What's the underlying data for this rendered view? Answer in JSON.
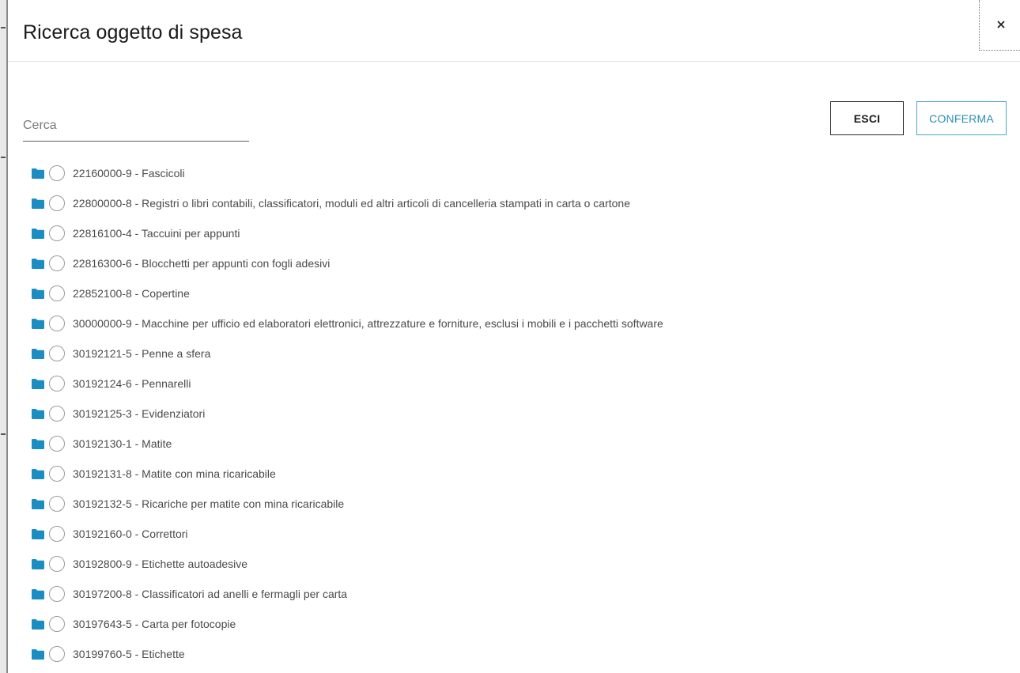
{
  "dialog": {
    "title": "Ricerca oggetto di spesa",
    "close_glyph": "×"
  },
  "search": {
    "placeholder": "Cerca",
    "value": ""
  },
  "buttons": {
    "exit_label": "ESCI",
    "confirm_label": "CONFERMA"
  },
  "icons": {
    "folder": "folder-icon",
    "close": "close-icon",
    "radio": "radio-empty"
  },
  "colors": {
    "accent": "#1b8dc2",
    "confirm_border": "#4aa7c2",
    "label_text": "#4a4a4a"
  },
  "items": [
    {
      "label": "22160000-9 - Fascicoli"
    },
    {
      "label": "22800000-8 - Registri o libri contabili, classificatori, moduli ed altri articoli di cancelleria stampati in carta o cartone"
    },
    {
      "label": "22816100-4 - Taccuini per appunti"
    },
    {
      "label": "22816300-6 - Blocchetti per appunti con fogli adesivi"
    },
    {
      "label": "22852100-8 - Copertine"
    },
    {
      "label": "30000000-9 - Macchine per ufficio ed elaboratori elettronici, attrezzature e forniture, esclusi i mobili e i pacchetti software"
    },
    {
      "label": "30192121-5 - Penne a sfera"
    },
    {
      "label": "30192124-6 - Pennarelli"
    },
    {
      "label": "30192125-3 - Evidenziatori"
    },
    {
      "label": "30192130-1 - Matite"
    },
    {
      "label": "30192131-8 - Matite con mina ricaricabile"
    },
    {
      "label": "30192132-5 - Ricariche per matite con mina ricaricabile"
    },
    {
      "label": "30192160-0 - Correttori"
    },
    {
      "label": "30192800-9 - Etichette autoadesive"
    },
    {
      "label": "30197200-8 - Classificatori ad anelli e fermagli per carta"
    },
    {
      "label": "30197643-5 - Carta per fotocopie"
    },
    {
      "label": "30199760-5 - Etichette"
    }
  ]
}
